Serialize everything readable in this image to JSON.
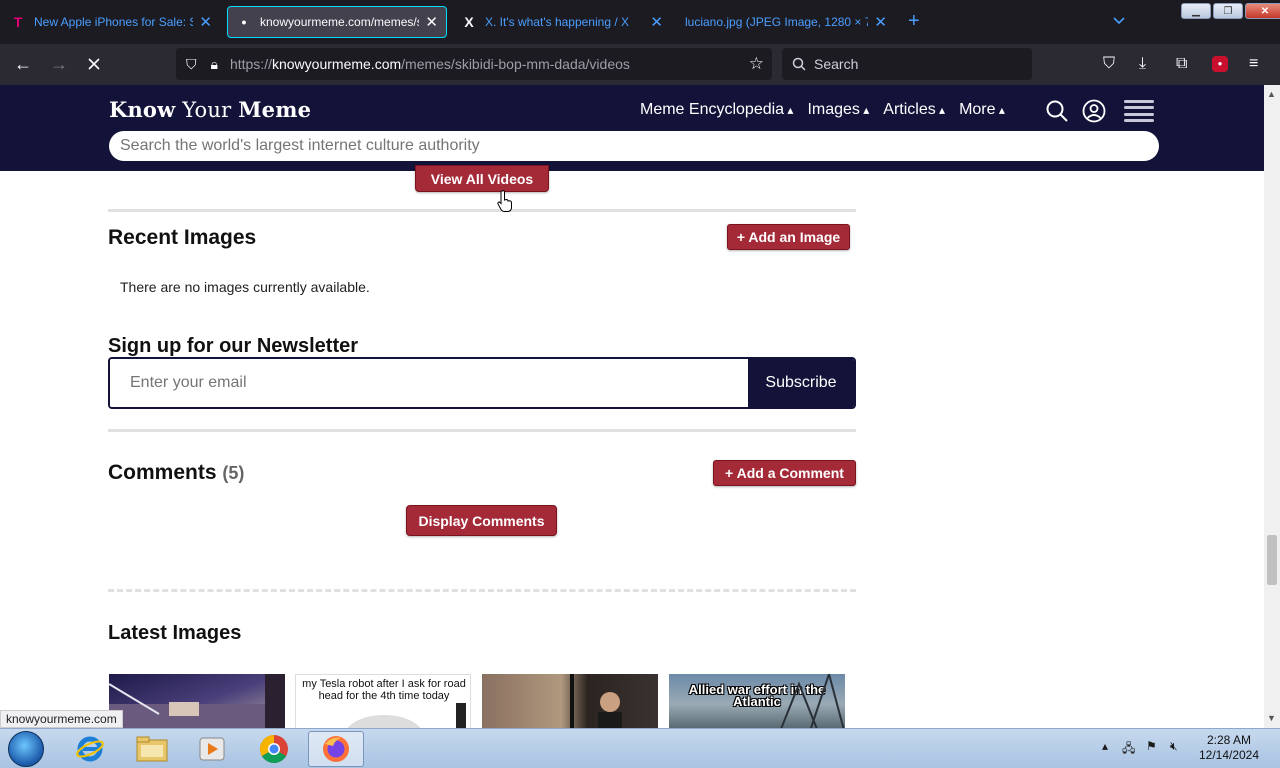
{
  "browser": {
    "tabs": [
      {
        "title": "New Apple iPhones for Sale: Sh",
        "favicon": "T"
      },
      {
        "title": "knowyourmeme.com/memes/s",
        "favicon": "•"
      },
      {
        "title": "X. It's what's happening / X",
        "favicon": "X"
      },
      {
        "title": "luciano.jpg (JPEG Image, 1280 × 72",
        "favicon": ""
      }
    ],
    "url_prefix": "https://",
    "url_domain": "knowyourmeme.com",
    "url_path": "/memes/skibidi-bop-mm-dada/videos",
    "search_placeholder": "Search",
    "status_url": "knowyourmeme.com"
  },
  "site": {
    "logo_bold": "Know",
    "logo_regular": "Your",
    "logo_bold2": "Meme",
    "nav": [
      "Meme Encyclopedia",
      "Images",
      "Articles",
      "More"
    ],
    "search_placeholder": "Search the world's largest internet culture authority"
  },
  "content": {
    "view_all_videos": "View All Videos",
    "recent_images_title": "Recent Images",
    "add_image": "+ Add an Image",
    "no_images": "There are no images currently available.",
    "newsletter_title": "Sign up for our Newsletter",
    "email_placeholder": "Enter your email",
    "subscribe": "Subscribe",
    "comments_title": "Comments",
    "comments_count": "(5)",
    "add_comment": "+ Add a Comment",
    "display_comments": "Display Comments",
    "latest_images_title": "Latest Images",
    "thumbs": [
      {
        "caption": ""
      },
      {
        "caption": "my Tesla robot after I ask for road head for the 4th time today"
      },
      {
        "caption": ""
      },
      {
        "caption": "Allied war effort in the Atlantic"
      }
    ]
  },
  "taskbar": {
    "time": "2:28 AM",
    "date": "12/14/2024"
  },
  "colors": {
    "kym_navy": "#13133a",
    "kym_red": "#a52a38",
    "firefox_dark": "#1c1b22"
  }
}
